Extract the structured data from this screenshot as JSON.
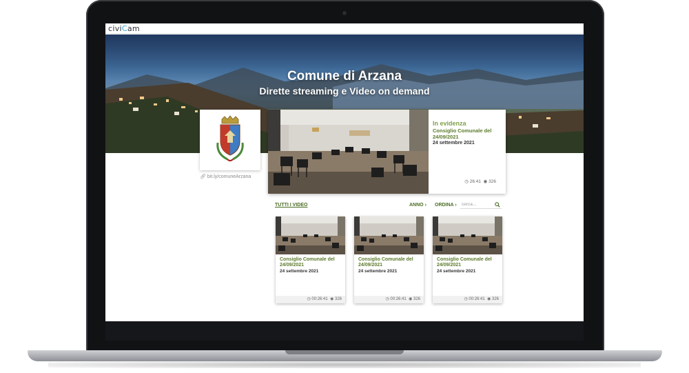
{
  "app": {
    "logo_text_a": "civi",
    "logo_text_b": "C",
    "logo_text_c": "am"
  },
  "hero": {
    "title": "Comune di Arzana",
    "subtitle": "Dirette streaming e Video on demand"
  },
  "profile": {
    "short_link": "bit.ly/comuneArzana"
  },
  "featured": {
    "label": "In evidenza",
    "title": "Consiglio Comunale del 24/09/2021",
    "date": "24 settembre 2021",
    "duration": "26:41",
    "views": "326"
  },
  "filters": {
    "all_videos": "TUTTI I VIDEO",
    "year": "ANNO",
    "sort": "ORDINA",
    "search_placeholder": "cerca..."
  },
  "videos": [
    {
      "title": "Consiglio Comunale del 24/09/2021",
      "date": "24 settembre 2021",
      "duration": "00:26:41",
      "views": "326"
    },
    {
      "title": "Consiglio Comunale del 24/09/2021",
      "date": "24 settembre 2021",
      "duration": "00:26:41",
      "views": "326"
    },
    {
      "title": "Consiglio Comunale del 24/09/2021",
      "date": "24 settembre 2021",
      "duration": "00:26:41",
      "views": "326"
    }
  ],
  "colors": {
    "accent_green": "#5c7a2a",
    "brand_blue": "#3ba9d8"
  },
  "icons": {
    "clock": "clock-icon",
    "views": "eye-icon",
    "link": "link-icon",
    "search": "search-icon",
    "chevron": "chevron-right-icon"
  }
}
